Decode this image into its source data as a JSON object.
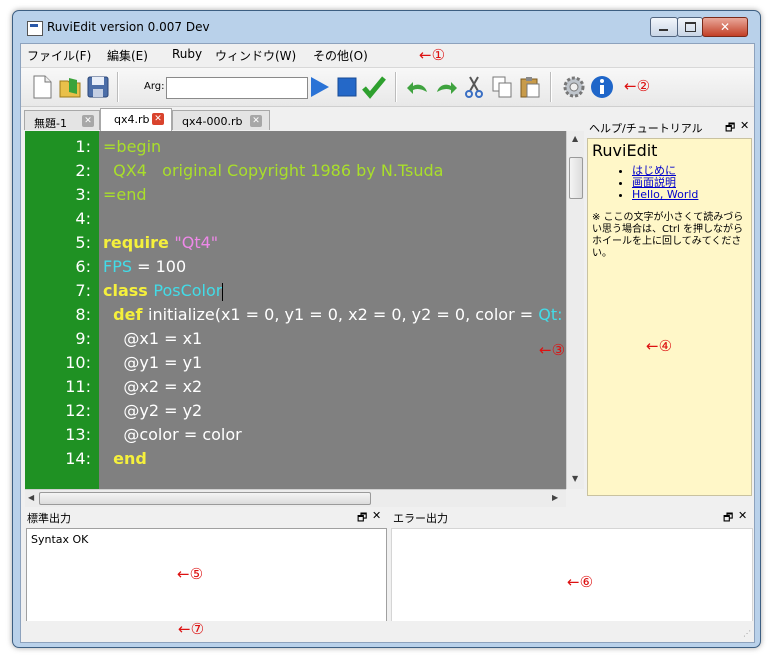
{
  "window": {
    "title": "RuviEdit version 0.007 Dev",
    "close_label": "✕"
  },
  "menu": [
    "ファイル(F)",
    "編集(E)",
    "Ruby",
    "ウィンドウ(W)",
    "その他(O)"
  ],
  "toolbar": {
    "arg_label": "Arg:",
    "arg_value": ""
  },
  "tabs": [
    {
      "label": "無題-1",
      "active": false
    },
    {
      "label": "qx4.rb",
      "active": true
    },
    {
      "label": "qx4-000.rb",
      "active": false
    }
  ],
  "editor": {
    "lines": [
      {
        "num": "1:",
        "segs": [
          {
            "t": "=begin",
            "c": "cm"
          }
        ]
      },
      {
        "num": "2:",
        "segs": [
          {
            "t": "  QX4   original Copyright 1986 by N.Tsuda",
            "c": "cm"
          }
        ]
      },
      {
        "num": "3:",
        "segs": [
          {
            "t": "=end",
            "c": "cm"
          }
        ]
      },
      {
        "num": "4:",
        "segs": []
      },
      {
        "num": "5:",
        "segs": [
          {
            "t": "require ",
            "c": "kw"
          },
          {
            "t": "\"Qt4\"",
            "c": "str"
          }
        ]
      },
      {
        "num": "6:",
        "segs": [
          {
            "t": "FPS",
            "c": "cst"
          },
          {
            "t": " = 100",
            "c": "plain"
          }
        ]
      },
      {
        "num": "7:",
        "segs": [
          {
            "t": "class ",
            "c": "kw"
          },
          {
            "t": "PosColor",
            "c": "cst"
          }
        ],
        "cursor": true
      },
      {
        "num": "8:",
        "segs": [
          {
            "t": "  ",
            "c": "plain"
          },
          {
            "t": "def ",
            "c": "kw"
          },
          {
            "t": "initialize(x1 = 0, y1 = 0, x2 = 0, y2 = 0, color = ",
            "c": "plain"
          },
          {
            "t": "Qt:",
            "c": "cst"
          }
        ]
      },
      {
        "num": "9:",
        "segs": [
          {
            "t": "    @x1 = x1",
            "c": "plain"
          }
        ]
      },
      {
        "num": "10:",
        "segs": [
          {
            "t": "    @y1 = y1",
            "c": "plain"
          }
        ]
      },
      {
        "num": "11:",
        "segs": [
          {
            "t": "    @x2 = x2",
            "c": "plain"
          }
        ]
      },
      {
        "num": "12:",
        "segs": [
          {
            "t": "    @y2 = y2",
            "c": "plain"
          }
        ]
      },
      {
        "num": "13:",
        "segs": [
          {
            "t": "    @color = color",
            "c": "plain"
          }
        ]
      },
      {
        "num": "14:",
        "segs": [
          {
            "t": "  ",
            "c": "plain"
          },
          {
            "t": "end",
            "c": "kw"
          }
        ]
      }
    ]
  },
  "help_dock": {
    "title": "ヘルプ/チュートリアル",
    "heading": "RuviEdit",
    "links": [
      "はじめに",
      "画面説明",
      "Hello, World"
    ],
    "note": "※ ここの文字が小さくて読みづらい思う場合は、Ctrl を押しながらホイールを上に回してみてください。"
  },
  "stdout_dock": {
    "title": "標準出力",
    "content": "Syntax OK"
  },
  "stderr_dock": {
    "title": "エラー出力",
    "content": ""
  },
  "dock_buttons": {
    "float": "🗗",
    "close": "✕"
  },
  "annotations": {
    "a1": "←①",
    "a2": "←②",
    "a3": "←③",
    "a4": "←④",
    "a5": "←⑤",
    "a6": "←⑥",
    "a7": "←⑦"
  },
  "colors": {
    "gutter": "#1f9123",
    "editor_bg": "#808080",
    "keyword": "#f5f03c",
    "comment": "#a9df2a",
    "string": "#ee88e8",
    "constant": "#42dce8",
    "annotation": "#dd1111"
  }
}
